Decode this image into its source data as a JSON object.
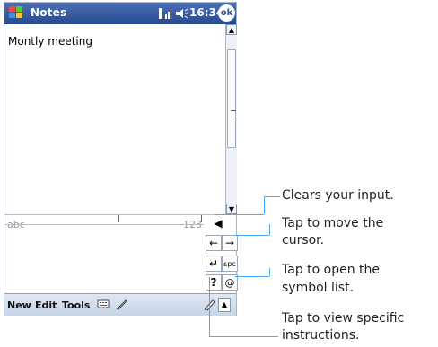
{
  "window": {
    "title": "Notes",
    "time": "16:34",
    "ok_label": "ok"
  },
  "document": {
    "text": "Montly meeting"
  },
  "input_panel": {
    "left_label": "abc",
    "right_label": "123"
  },
  "toolbar": {
    "new_label": "New",
    "edit_label": "Edit",
    "tools_label": "Tools"
  },
  "callouts": {
    "clear": "Clears your input.",
    "move_line1": "Tap to move the",
    "move_line2": "cursor.",
    "symbol_line1": "Tap to open the",
    "symbol_line2": "symbol list.",
    "help_line1": "Tap to view specific",
    "help_line2": "instructions."
  },
  "colors": {
    "title_bar": "#2d4f96",
    "callout_line": "#4aa7ff",
    "toolbar": "#d4dfec"
  },
  "icons": {
    "start": "windows-logo-icon",
    "signal": "signal-icon",
    "speaker": "speaker-icon",
    "backspace": "backspace-icon",
    "left_arrow": "left-arrow-icon",
    "right_arrow": "right-arrow-icon",
    "enter": "enter-icon",
    "space": "space-icon",
    "at": "at-sign-icon",
    "help": "question-icon",
    "pen": "pen-icon",
    "keyboard": "keyboard-icon"
  }
}
